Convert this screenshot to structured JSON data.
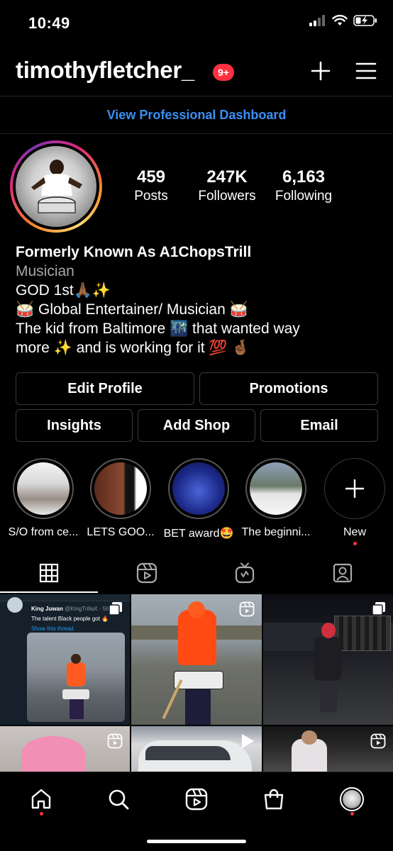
{
  "status": {
    "time": "10:49"
  },
  "header": {
    "username": "timothyfletcher_",
    "notifications": "9+"
  },
  "dashboard_link": "View Professional Dashboard",
  "stats": [
    {
      "value": "459",
      "label": "Posts"
    },
    {
      "value": "247K",
      "label": "Followers"
    },
    {
      "value": "6,163",
      "label": "Following"
    }
  ],
  "bio": {
    "name": "Formerly Known As A1ChopsTrill",
    "category": "Musician",
    "lines": [
      "GOD 1st🙏🏾✨",
      "🥁 Global Entertainer/ Musician 🥁",
      "The kid from Baltimore 🌃 that wanted way",
      "more ✨ and is working for it 💯 🤞🏾"
    ]
  },
  "buttons": {
    "edit_profile": "Edit Profile",
    "promotions": "Promotions",
    "insights": "Insights",
    "add_shop": "Add Shop",
    "email": "Email"
  },
  "highlights": [
    {
      "label": "S/O from ce...",
      "color": "#d9d9d9"
    },
    {
      "label": "LETS GOO...",
      "color": "#6b3a2a"
    },
    {
      "label": "BET award🤩",
      "color": "#1c2a8a"
    },
    {
      "label": "The beginni...",
      "color": "#c9c9c9"
    },
    {
      "label": "New"
    }
  ],
  "tabs": [
    "grid-icon",
    "reels-icon",
    "igtv-icon",
    "tagged-icon"
  ],
  "grid_posts": [
    {
      "handle": "King Juwan",
      "subhandle": "@KingTrillaX · 5h",
      "caption": "The talent Black people got 🔥",
      "link": "Show this thread",
      "overlay": "carousel-icon"
    },
    {
      "overlay": "reel-icon"
    },
    {
      "overlay": "carousel-icon"
    },
    {
      "overlay": "reel-icon"
    },
    {
      "overlay": "play-icon"
    },
    {
      "overlay": "reel-icon"
    }
  ],
  "nav": [
    "home-icon",
    "search-icon",
    "reels-icon",
    "shop-icon",
    "profile-avatar"
  ]
}
